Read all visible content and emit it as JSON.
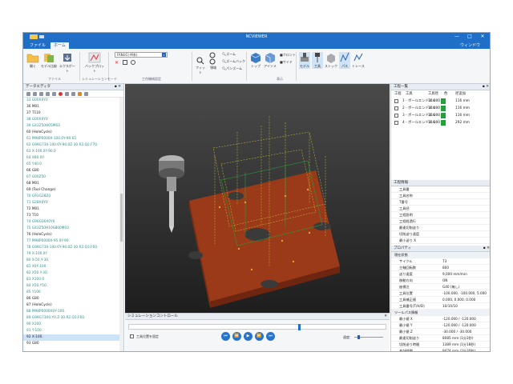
{
  "window": {
    "title": "NCVIEWER",
    "controls": [
      "—",
      "□",
      "✕"
    ]
  },
  "menu": {
    "tabs": [
      "ファイル",
      "ホーム"
    ],
    "right": "ウィンドウ"
  },
  "ribbon": {
    "buttons": [
      {
        "label": "開く",
        "icon": "folder-icon"
      },
      {
        "label": "モデル比較",
        "icon": "compare-icon"
      },
      {
        "label": "エクスポート",
        "icon": "export-icon"
      },
      {
        "label": "バックプロット",
        "icon": "backplot-icon"
      },
      {
        "label": "フィット",
        "icon": "fit-icon"
      },
      {
        "label": "領域",
        "icon": "region-icon"
      },
      {
        "label": "トップ",
        "icon": "cube-top-icon"
      },
      {
        "label": "アイソメ",
        "icon": "cube-iso-icon"
      },
      {
        "label": "モデル",
        "icon": "model-icon"
      },
      {
        "label": "工具",
        "icon": "tool-icon"
      },
      {
        "label": "ストック",
        "icon": "stock-icon"
      },
      {
        "label": "パス",
        "icon": "path-icon"
      },
      {
        "label": "トレース",
        "icon": "trace-icon"
      }
    ],
    "controller": "FANUC(-M系)",
    "zoom": [
      "ズーム",
      "ズームバック",
      "パンズーム"
    ],
    "views": [
      "フロント",
      "サイド"
    ],
    "groups": [
      "ファイル",
      "シミュレーションモード",
      "工作機械設定",
      "表示"
    ]
  },
  "left_panel": {
    "title": "データエディタ",
    "lines": [
      {
        "t": "33  G00X0Y0",
        "c": "c"
      },
      {
        "t": "36  M01",
        "c": "k"
      },
      {
        "t": "37  T110",
        "c": "k"
      },
      {
        "t": "38  G00X0Y0",
        "c": "c"
      },
      {
        "t": "39  G43Z50H05M03",
        "c": "c"
      },
      {
        "t": "60  (HoleCycle)",
        "c": "k"
      },
      {
        "t": "61  M98P0000X-100.0Y-90.65",
        "c": "c"
      },
      {
        "t": "62  G99G73X-100.0Y-90.0Z-30.R2.Q2.F70.",
        "c": "c"
      },
      {
        "t": "63  X-100.0Y-90.0",
        "c": "c"
      },
      {
        "t": "64  X60.0Y-",
        "c": "c"
      },
      {
        "t": "65  Y40.0",
        "c": "c"
      },
      {
        "t": "66  G80",
        "c": "k"
      },
      {
        "t": "67  G00Z50",
        "c": "c"
      },
      {
        "t": "68  M01",
        "c": "k"
      },
      {
        "t": "69  (Tool Change)",
        "c": "k"
      },
      {
        "t": "70  G91G28Z0",
        "c": "c"
      },
      {
        "t": "71  G28X0Y0",
        "c": "c"
      },
      {
        "t": "72  M01",
        "c": "k"
      },
      {
        "t": "73  T10",
        "c": "k"
      },
      {
        "t": "74  G90G00X0Y0",
        "c": "c"
      },
      {
        "t": "75  G43Z50H10S800M03",
        "c": "c"
      },
      {
        "t": "76  (HoleCycle)",
        "c": "k"
      },
      {
        "t": "77  M98P0000X-95.0Y-90",
        "c": "c"
      },
      {
        "t": "78  G99G73X-100.0Y-90.0Z-30.R2.Q3.F60.",
        "c": "c"
      },
      {
        "t": "79  X-100.0Y",
        "c": "c"
      },
      {
        "t": "80  X-50.Y-30.",
        "c": "c"
      },
      {
        "t": "81  X0Y-100.",
        "c": "c"
      },
      {
        "t": "82  X50.Y-30.",
        "c": "c"
      },
      {
        "t": "83  X100.0",
        "c": "c"
      },
      {
        "t": "84  X50.Y50.",
        "c": "c"
      },
      {
        "t": "85  Y100",
        "c": "c"
      },
      {
        "t": "86  G80",
        "c": "k"
      },
      {
        "t": "87  (HoleCycle)",
        "c": "k"
      },
      {
        "t": "88  M98P0000X0Y-100.",
        "c": "c"
      },
      {
        "t": "89  G99G73X0.Y0.Z-30.R2.Q3.F60.",
        "c": "c"
      },
      {
        "t": "90  X100.",
        "c": "c"
      },
      {
        "t": "91  Y-100.",
        "c": "c"
      },
      {
        "t": "92  X-100.",
        "c": "k",
        "sel": true
      },
      {
        "t": "93  G80",
        "c": "k"
      }
    ]
  },
  "right_panel": {
    "tool_list": {
      "title": "工程一覧",
      "headers": [
        "工程",
        "工具",
        "工具径",
        "色",
        "径追加"
      ],
      "rows": [
        {
          "name": "1 - ボールエンドミル",
          "dia": "10.000",
          "extra": "116 mm"
        },
        {
          "name": "2 - ボールエンドミル",
          "dia": "10.000",
          "extra": "116 mm"
        },
        {
          "name": "3 - ボールエンドミル",
          "dia": "10.000",
          "extra": "116 mm"
        },
        {
          "name": "4 - ボールエンドミル",
          "dia": "10.000",
          "extra": "292 mm"
        }
      ]
    },
    "process_info": {
      "title": "工程情報",
      "items": [
        "工具番",
        "工具名称",
        "T番号",
        "工具径",
        "工程説明",
        "工程経過行",
        "最速切削送り",
        "切削送り速度",
        "最小送り X"
      ]
    },
    "properties": {
      "title": "プロパティ",
      "sections": [
        {
          "name": "現在状態",
          "rows": [
            [
              "サイクル",
              "73"
            ],
            [
              "主軸回転数",
              "800"
            ],
            [
              "送り速度",
              "9,000 mm/min"
            ],
            [
              "移動方向",
              "ON"
            ],
            [
              "座標注",
              "G40 (無し)"
            ],
            [
              "工具位置",
              "-100.000, -100.000, 5.000"
            ],
            [
              "工具補正値",
              "0.000, 0.000, 0.000"
            ],
            [
              "工具番号(T/H/D)",
              "10/10/10"
            ]
          ]
        },
        {
          "name": "ツールパス情報",
          "rows": [
            [
              "最小値 X",
              "-120.000 / -120.000"
            ],
            [
              "最小値 Y",
              "-120.000 / -120.000"
            ],
            [
              "最小値 Z",
              "-30.000 / -30.000"
            ],
            [
              "最速切削送り",
              "8085 mm (1分2秒)"
            ],
            [
              "切削送り時間",
              "1389 mm (1分18秒)"
            ],
            [
              "合計時間",
              "9474 mm (2分30秒)"
            ]
          ]
        }
      ]
    }
  },
  "simulation": {
    "title": "シミュレーションコントロール",
    "checkbox": "工具位置を固定",
    "speed_label": "速度:",
    "progress": 0.66,
    "buttons": [
      "⏮",
      "⏪",
      "▶",
      "⏩",
      "⏭"
    ]
  },
  "colors": {
    "accent": "#1f6fc9",
    "plate": "#a9401c",
    "tool_green": "#22a339"
  }
}
